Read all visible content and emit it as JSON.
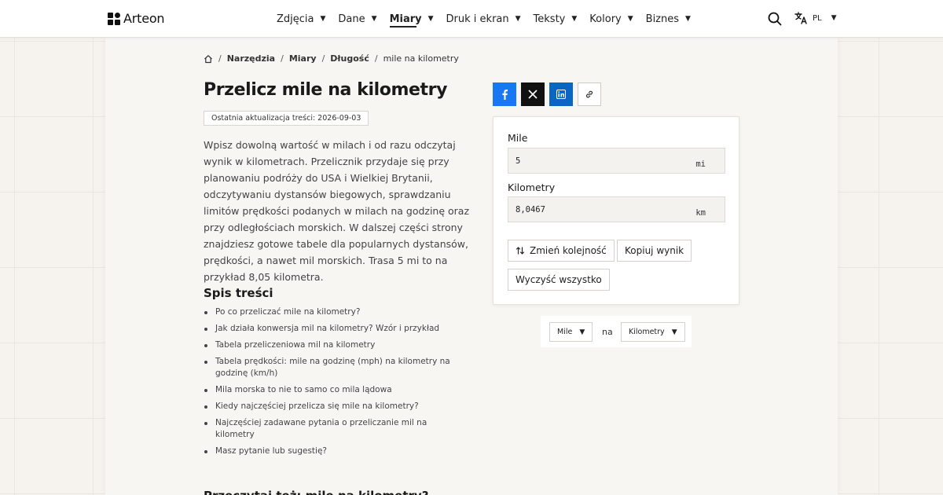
{
  "header": {
    "brand": "Arteon",
    "nav": [
      {
        "label": "Zdjęcia",
        "active": false
      },
      {
        "label": "Dane",
        "active": false
      },
      {
        "label": "Miary",
        "active": true
      },
      {
        "label": "Druk i ekran",
        "active": false
      },
      {
        "label": "Teksty",
        "active": false
      },
      {
        "label": "Kolory",
        "active": false
      },
      {
        "label": "Biznes",
        "active": false
      }
    ],
    "language": "PL"
  },
  "breadcrumb": {
    "items": [
      "Narzędzia",
      "Miary",
      "Długość"
    ],
    "current": "mile na kilometry"
  },
  "page": {
    "title": "Przelicz mile na kilometry",
    "updated": "Ostatnia aktualizacja treści: 2026-09-03",
    "intro": "Wpisz dowolną wartość w milach i od razu odczytaj wynik w kilometrach. Przelicznik przydaje się przy planowaniu podróży do USA i Wielkiej Brytanii, odczytywaniu dystansów biegowych, sprawdzaniu limitów prędkości podanych w milach na godzinę oraz przy odległościach morskich. W dalszej części strony znajdziesz gotowe tabele dla popularnych dystansów, prędkości, a nawet mil morskich. Trasa 5 mi to na przykład 8,05 kilometra.",
    "toc_title": "Spis treści",
    "toc": [
      "Po co przeliczać mile na kilometry?",
      "Jak działa konwersja mil na kilometry? Wzór i przykład",
      "Tabela przeliczeniowa mil na kilometry",
      "Tabela prędkości: mile na godzinę (mph) na kilometry na godzinę (km/h)",
      "Mila morska to nie to samo co mila lądowa",
      "Kiedy najczęściej przelicza się mile na kilometry?",
      "Najczęściej zadawane pytania o przeliczanie mil na kilometry",
      "Masz pytanie lub sugestię?"
    ],
    "next_heading": "Przeczytaj też: mile na kilometry?"
  },
  "converter": {
    "from_label": "Mile",
    "from_value": "5",
    "from_unit": "mi",
    "to_label": "Kilometry",
    "to_value": "8,0467",
    "to_unit": "km",
    "swap_label": "Zmień kolejność",
    "copy_label": "Kopiuj wynik",
    "clear_label": "Wyczyść wszystko"
  },
  "unit_selector": {
    "from": "Mile",
    "joiner": "na",
    "to": "Kilometry"
  },
  "colors": {
    "facebook": "#1877f2",
    "x": "#111111",
    "linkedin": "#0a66c2"
  }
}
